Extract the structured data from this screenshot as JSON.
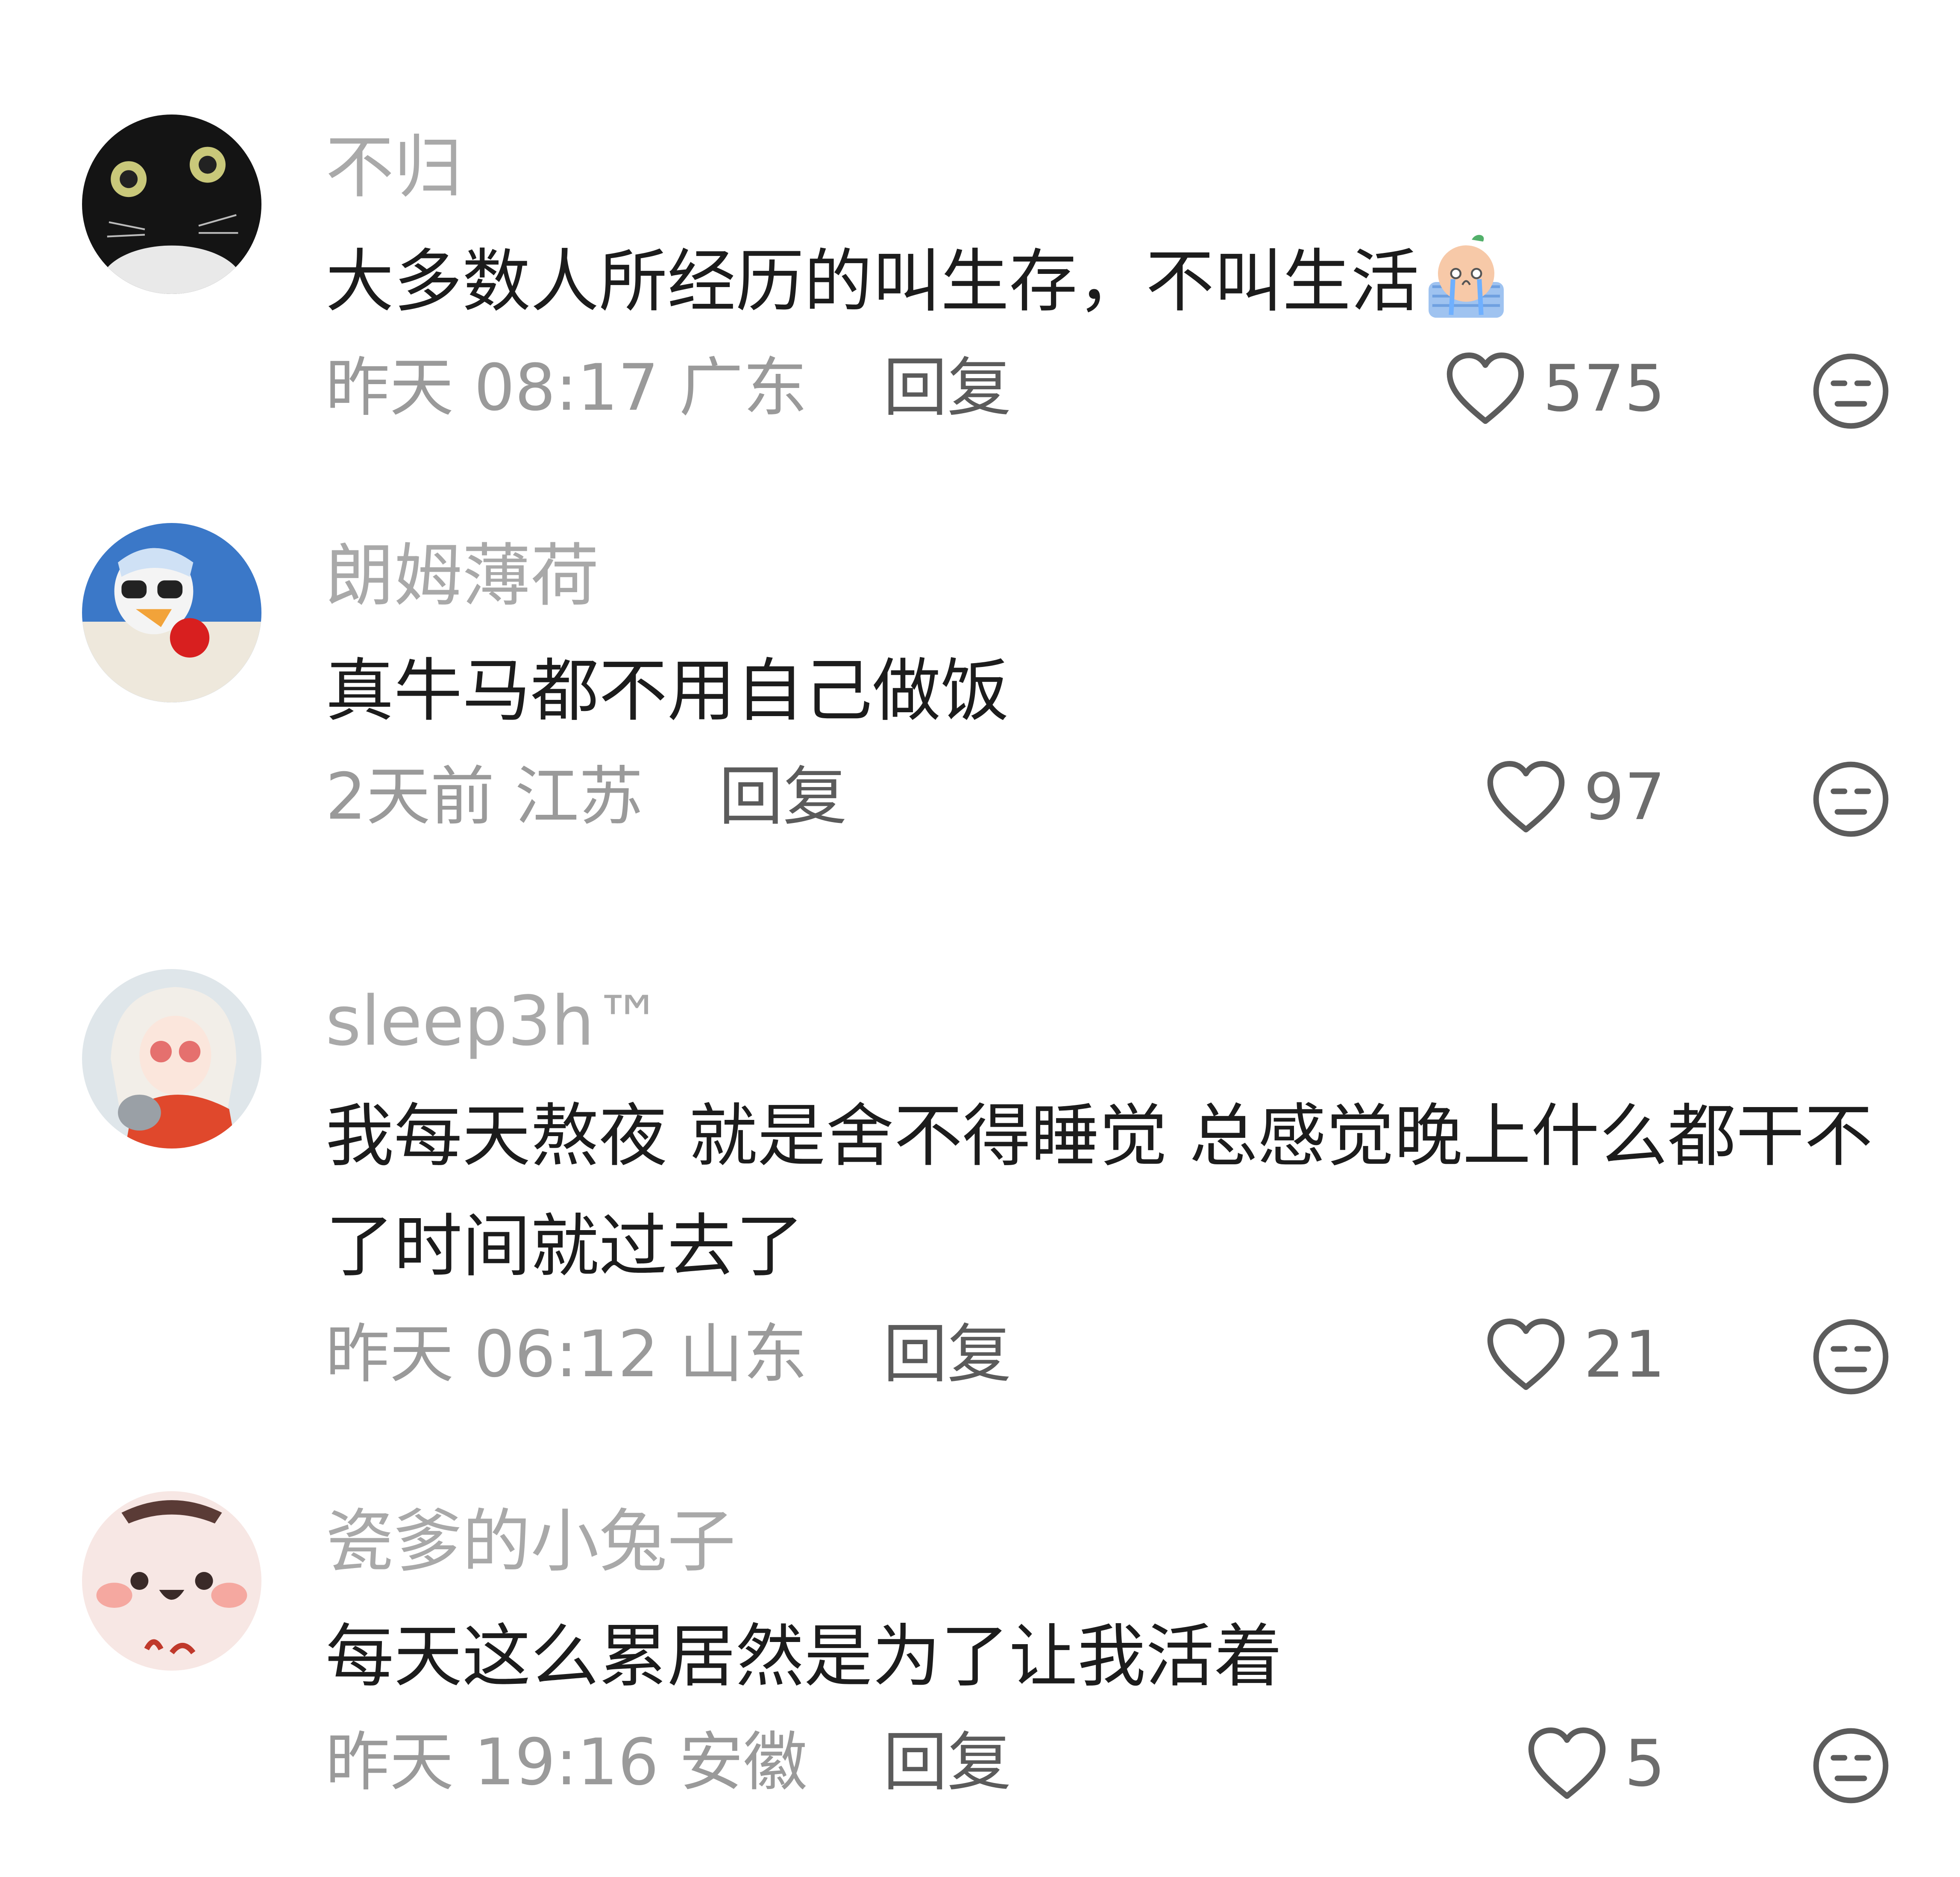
{
  "comments": [
    {
      "username": "不归",
      "content": "大多数人所经历的叫生存，不叫生活",
      "time": "昨天 08:17",
      "location": "广东",
      "reply_label": "回复",
      "likes": "575",
      "inline_emoji": "crying-emoji"
    },
    {
      "username": "朗姆薄荷",
      "content": "真牛马都不用自己做饭",
      "time": "2天前",
      "location": "江苏",
      "reply_label": "回复",
      "likes": "97"
    },
    {
      "username": "sleep3h™",
      "content": "我每天熬夜 就是舍不得睡觉 总感觉晚上什么都干不了时间就过去了",
      "time": "昨天 06:12",
      "location": "山东",
      "reply_label": "回复",
      "likes": "21"
    },
    {
      "username": "瓷爹的小兔子",
      "content": "每天这么累居然是为了让我活着",
      "time": "昨天 19:16",
      "location": "安徽",
      "reply_label": "回复",
      "likes": "5"
    }
  ],
  "icons": {
    "like": "heart-outline-icon",
    "dislike": "unamused-face-icon"
  },
  "colors": {
    "username": "#a9a9a9",
    "content": "#1c1c1c",
    "meta": "#9a9a9a",
    "reply": "#5b5b5b"
  }
}
